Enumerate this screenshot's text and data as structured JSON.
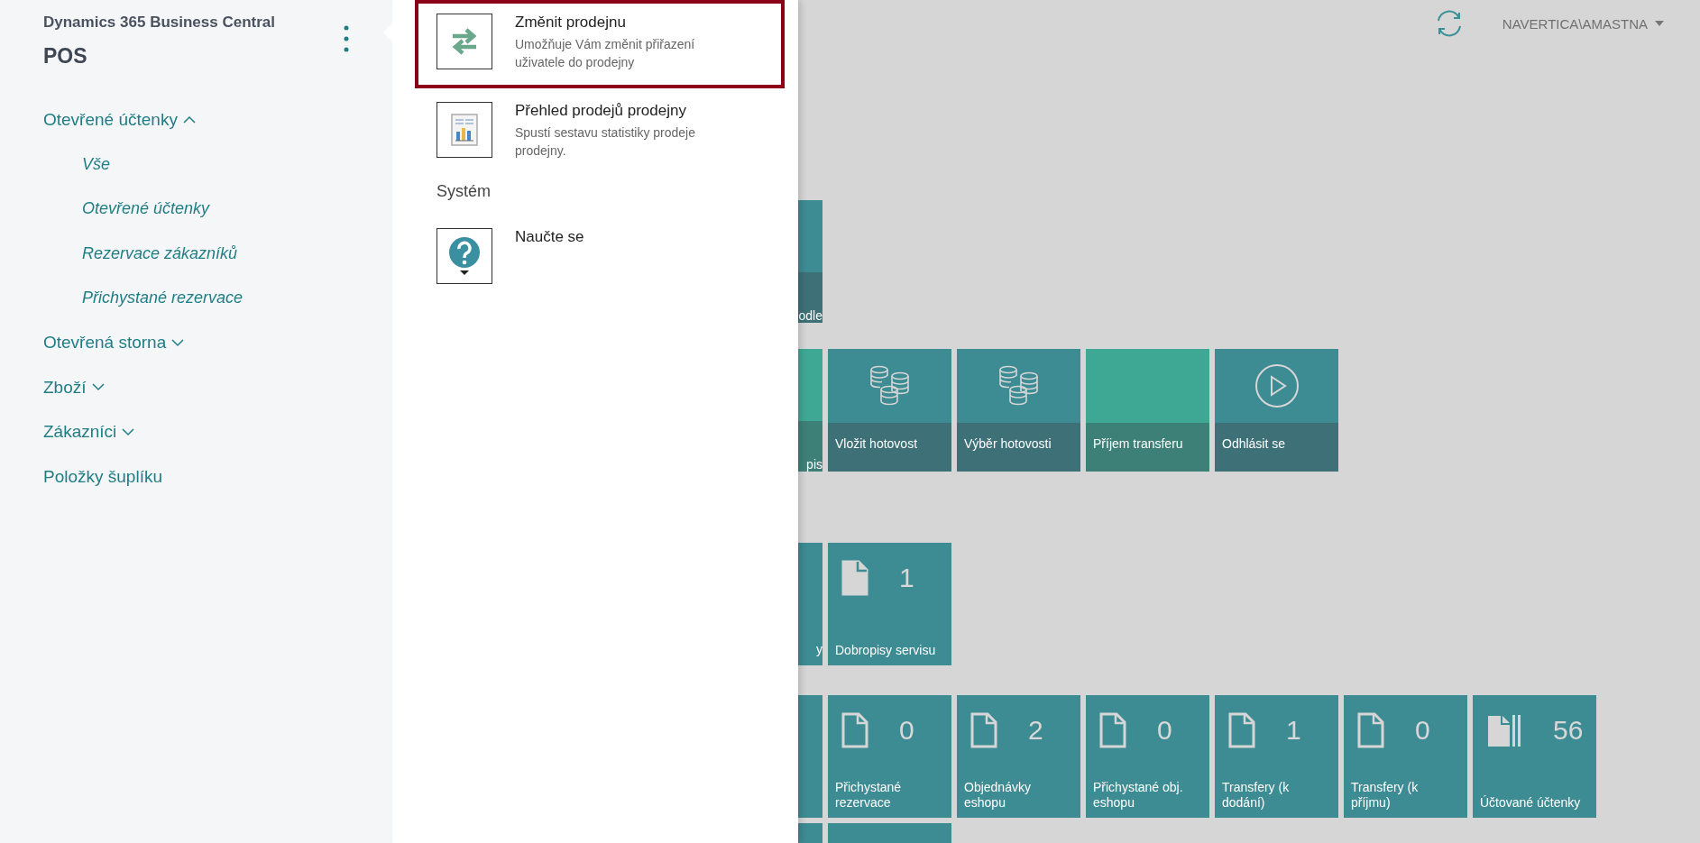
{
  "sidebar": {
    "app_name": "Dynamics 365 Business Central",
    "role": "POS",
    "nav": [
      {
        "kind": "group",
        "label": "Otevřené účtenky",
        "expanded": true,
        "children": [
          {
            "label": "Vše"
          },
          {
            "label": "Otevřené účtenky"
          },
          {
            "label": "Rezervace zákazníků"
          },
          {
            "label": "Přichystané rezervace"
          }
        ]
      },
      {
        "kind": "group",
        "label": "Otevřená storna",
        "expanded": false
      },
      {
        "kind": "group",
        "label": "Zboží",
        "expanded": false
      },
      {
        "kind": "group",
        "label": "Zákazníci",
        "expanded": false
      },
      {
        "kind": "link",
        "label": "Položky šuplíku"
      }
    ]
  },
  "action_panel": {
    "items": [
      {
        "kind": "swap",
        "title": "Změnit prodejnu",
        "description": "Umožňuje Vám změnit přiřazení uživatele do prodejny",
        "highlighted": true
      },
      {
        "kind": "report",
        "title": "Přehled prodejů prodejny",
        "description": "Spustí sestavu statistiky prodeje prodejny.",
        "highlighted": false
      },
      {
        "kind": "heading",
        "title": "Systém"
      },
      {
        "kind": "help",
        "title": "Naučte se",
        "highlighted": false
      }
    ]
  },
  "top_bar": {
    "user": "NAVERTICA\\AMASTNA"
  },
  "tile_rows": [
    {
      "tiles": [
        {
          "kind": "partial",
          "label": "odle",
          "color": "#3d8b93"
        }
      ]
    },
    {
      "tiles": [
        {
          "kind": "partial",
          "label": "pis",
          "color": "#3ea894"
        },
        {
          "kind": "coins",
          "label": "Vložit hotovost",
          "color": "#3d8b93"
        },
        {
          "kind": "coins",
          "label": "Výběr hotovosti",
          "color": "#3d8b93"
        },
        {
          "kind": "plain",
          "label": "Příjem transferu",
          "color": "#3ea894"
        },
        {
          "kind": "play",
          "label": "Odhlásit se",
          "color": "#3d8b93"
        }
      ]
    },
    {
      "tiles": [
        {
          "kind": "partial-count",
          "label": "y",
          "color": "#3d8b93"
        },
        {
          "kind": "count",
          "count": "1",
          "label": "Dobropisy servisu",
          "color": "#3d8b93"
        }
      ]
    },
    {
      "tiles": [
        {
          "kind": "partial-count",
          "color": "#3d8b93"
        },
        {
          "kind": "count",
          "count": "0",
          "label": "Přichystané rezervace",
          "color": "#3d8b93"
        },
        {
          "kind": "count",
          "count": "2",
          "label": "Objednávky eshopu",
          "color": "#3d8b93"
        },
        {
          "kind": "count",
          "count": "0",
          "label": "Přichystané obj. eshopu",
          "color": "#3d8b93"
        },
        {
          "kind": "count",
          "count": "1",
          "label": "Transfery (k dodání)",
          "color": "#3d8b93"
        },
        {
          "kind": "count",
          "count": "0",
          "label": "Transfery (k příjmu)",
          "color": "#3d8b93"
        },
        {
          "kind": "stack-count",
          "count": "56",
          "label": "Účtované účtenky",
          "color": "#3d8b93"
        }
      ]
    },
    {
      "tiles": [
        {
          "kind": "partial-count",
          "color": "#3d8b93"
        },
        {
          "kind": "count",
          "color": "#3d8b93"
        }
      ]
    }
  ]
}
